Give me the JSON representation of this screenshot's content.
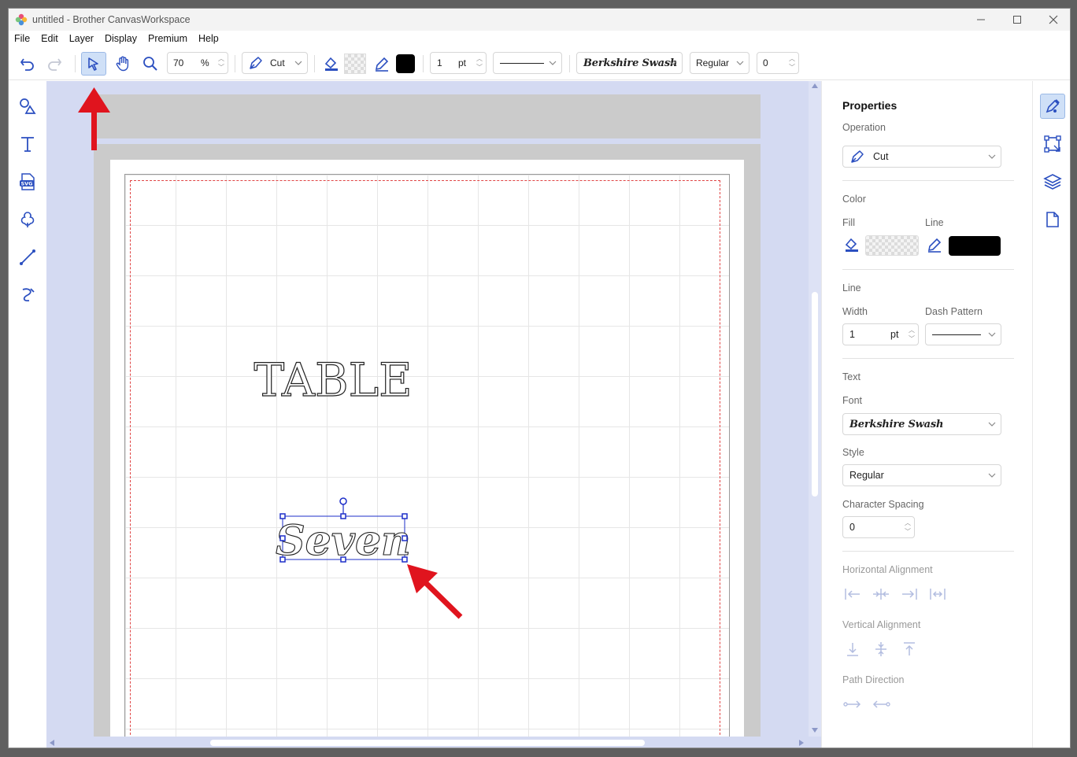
{
  "window": {
    "title": "untitled - Brother CanvasWorkspace"
  },
  "menu": [
    "File",
    "Edit",
    "Layer",
    "Display",
    "Premium",
    "Help"
  ],
  "toolbar": {
    "zoom_value": "70",
    "zoom_unit": "%",
    "operation": "Cut",
    "line_width": "1",
    "line_unit": "pt",
    "font": "Berkshire Swash",
    "style": "Regular",
    "char_spacing": "0"
  },
  "canvas": {
    "text_objects": [
      "TABLE",
      "Seven"
    ]
  },
  "properties": {
    "title": "Properties",
    "operation_label": "Operation",
    "operation_value": "Cut",
    "color_label": "Color",
    "fill_label": "Fill",
    "line_label": "Line",
    "line_section": "Line",
    "width_label": "Width",
    "dash_label": "Dash Pattern",
    "width_value": "1",
    "width_unit": "pt",
    "text_section": "Text",
    "font_label": "Font",
    "font_value": "Berkshire Swash",
    "style_label": "Style",
    "style_value": "Regular",
    "spacing_label": "Character Spacing",
    "spacing_value": "0",
    "halign_label": "Horizontal Alignment",
    "valign_label": "Vertical Alignment",
    "pathdir_label": "Path Direction"
  },
  "colors": {
    "accent": "#2b4fc0",
    "line_color": "#000000",
    "selected_tool_bg": "#cfe0f7",
    "canvas_bg": "#d4daf2",
    "arrow": "#e0141e"
  }
}
